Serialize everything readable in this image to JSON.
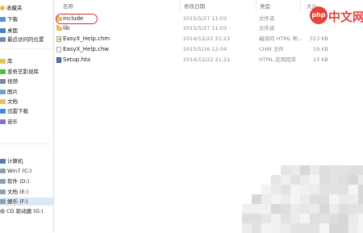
{
  "nav": {
    "items": [
      {
        "label": "收藏夹",
        "icon": "star-icon",
        "color": "#e9b949"
      },
      {
        "label": "下载",
        "icon": "download-folder-icon",
        "color": "#5a8fd1"
      },
      {
        "label": "桌面",
        "icon": "desktop-icon",
        "color": "#4a7fc1"
      },
      {
        "label": "最近访问的位置",
        "icon": "recent-places-icon",
        "color": "#6e8fb5"
      },
      {
        "label": "库",
        "icon": "libraries-icon",
        "color": "#e8c15a"
      },
      {
        "label": "爱奇艺影视库",
        "icon": "video-library-icon",
        "color": "#58b947"
      },
      {
        "label": "视频",
        "icon": "video-icon",
        "color": "#7a8a99"
      },
      {
        "label": "图片",
        "icon": "pictures-icon",
        "color": "#6ca0d8"
      },
      {
        "label": "文档",
        "icon": "documents-icon",
        "color": "#e8c15a"
      },
      {
        "label": "迅雷下载",
        "icon": "thunder-download-icon",
        "color": "#3d8ee0"
      },
      {
        "label": "音乐",
        "icon": "music-icon",
        "color": "#8c6ed1"
      },
      {
        "label": "计算机",
        "icon": "computer-icon",
        "color": "#5a7da8"
      },
      {
        "label": "Win7 (C:)",
        "icon": "drive-icon",
        "color": "#8aa0b8"
      },
      {
        "label": "软件 (D:)",
        "icon": "drive-icon",
        "color": "#8aa0b8"
      },
      {
        "label": "文档 (E:)",
        "icon": "drive-icon",
        "color": "#8aa0b8"
      },
      {
        "label": "娱乐 (F:)",
        "icon": "drive-icon",
        "color": "#8aa0b8"
      },
      {
        "label": "CD 驱动器 (G:)",
        "icon": "cd-drive-icon",
        "color": "#9aa8b5"
      }
    ]
  },
  "header": {
    "name": "名称",
    "date": "修改日期",
    "type": "类型",
    "size": "大小"
  },
  "files": [
    {
      "name": "include",
      "date": "2015/5/27 11:03",
      "type": "文件夹",
      "size": "",
      "icon": "folder-icon"
    },
    {
      "name": "lib",
      "date": "2015/5/27 11:03",
      "type": "文件夹",
      "size": "",
      "icon": "folder-icon"
    },
    {
      "name": "EasyX_Help.chm",
      "date": "2014/12/22 21:21",
      "type": "编译的 HTML 帮...",
      "size": "313 KB",
      "icon": "chm-file-icon"
    },
    {
      "name": "EasyX_Help.chw",
      "date": "2015/5/16 12:04",
      "type": "CHW 文件",
      "size": "19 KB",
      "icon": "chw-file-icon"
    },
    {
      "name": "Setup.hta",
      "date": "2014/12/22 21:21",
      "type": "HTML 应用程序",
      "size": "13 KB",
      "icon": "hta-file-icon"
    }
  ],
  "watermark": {
    "logo": "php",
    "text": "中文网"
  },
  "colors": {
    "accent": "#c0392b",
    "selection": "#dde8f5",
    "watermark": "#e4443a"
  }
}
